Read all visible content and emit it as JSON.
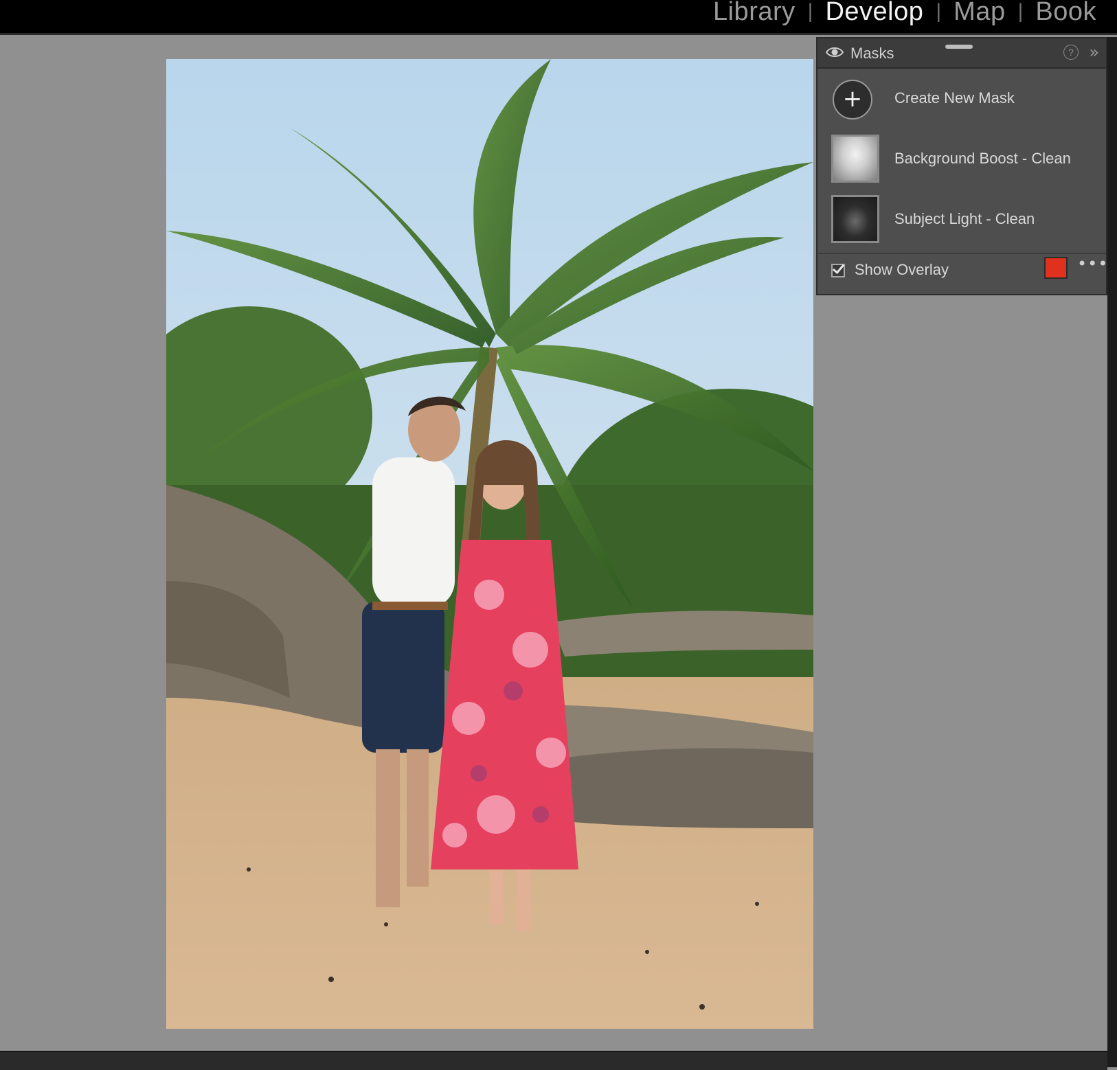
{
  "top_bar": {
    "modules": [
      {
        "label": "Library",
        "active": false
      },
      {
        "label": "Develop",
        "active": true
      },
      {
        "label": "Map",
        "active": false
      },
      {
        "label": "Book",
        "active": false
      }
    ],
    "separator": "|"
  },
  "masks_panel": {
    "title": "Masks",
    "help_symbol": "?",
    "collapse_symbol": "»",
    "create_new_mask": {
      "icon": "+",
      "label": "Create New Mask"
    },
    "masks": [
      {
        "label": "Background Boost - Clean"
      },
      {
        "label": "Subject Light - Clean"
      }
    ],
    "show_overlay": {
      "label": "Show Overlay",
      "checked": true,
      "color": "#e0301e"
    },
    "more_symbol": "•••"
  },
  "colors": {
    "panel_bg": "#4e4e4e",
    "workspace_bg": "#909090",
    "overlay_swatch": "#e0301e"
  }
}
